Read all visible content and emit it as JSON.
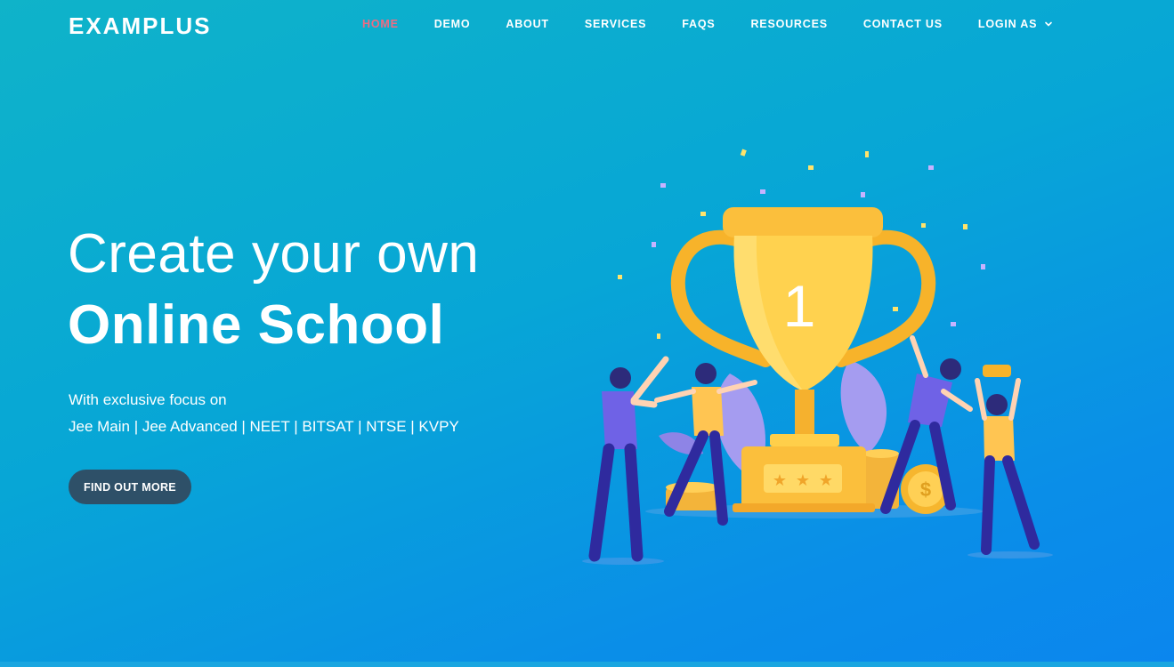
{
  "header": {
    "logo": "EXAMPLUS",
    "nav": [
      {
        "label": "HOME",
        "active": true
      },
      {
        "label": "DEMO"
      },
      {
        "label": "ABOUT"
      },
      {
        "label": "SERVICES"
      },
      {
        "label": "FAQS"
      },
      {
        "label": "RESOURCES"
      },
      {
        "label": "CONTACT US"
      },
      {
        "label": "LOGIN AS",
        "dropdown": true
      }
    ]
  },
  "hero": {
    "title_line1": "Create your own",
    "title_line2": "Online School",
    "subtitle_line1": "With exclusive focus on",
    "subtitle_line2": "Jee Main | Jee Advanced | NEET | BITSAT | NTSE | KVPY",
    "cta_label": "FIND OUT MORE"
  },
  "illustration": {
    "trophy_number": "1",
    "icons": [
      "trophy-icon",
      "coin-icon",
      "star-icon",
      "confetti",
      "leaf-icon"
    ]
  },
  "colors": {
    "active_nav": "#ee6b83",
    "button_bg": "#2e5068",
    "gradient_start": "#0fb3c9",
    "gradient_end": "#0b86ee",
    "trophy_gold": "#fbbf3c"
  }
}
